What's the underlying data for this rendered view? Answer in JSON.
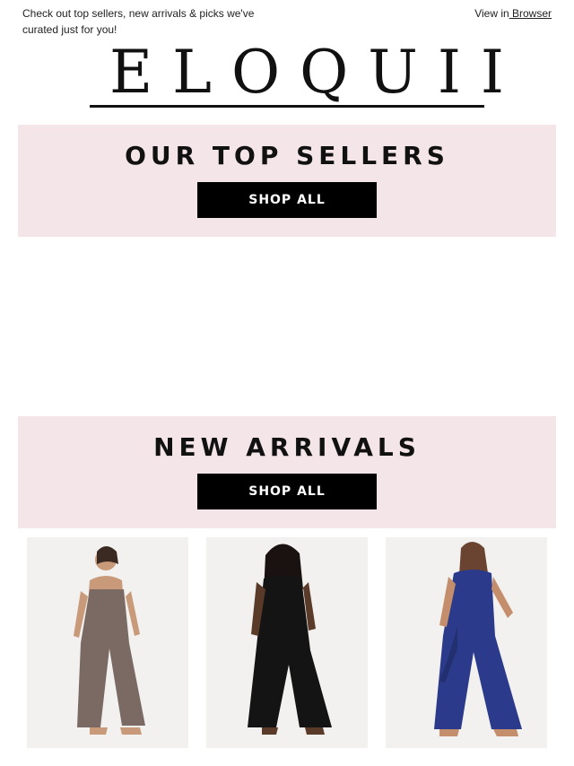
{
  "preheader": {
    "text": "Check out top sellers, new arrivals & picks we've curated just for you!",
    "view_in_label": "View in",
    "browser_link": " Browser"
  },
  "brand": {
    "logo_text": "ELOQUII"
  },
  "sections": [
    {
      "title": "OUR TOP SELLERS",
      "button_label": "SHOP ALL"
    },
    {
      "title": "NEW ARRIVALS",
      "button_label": "SHOP ALL"
    }
  ],
  "products": [
    {
      "image": "model-in-sequin-strapless-jumpsuit",
      "color": "#7a6a63"
    },
    {
      "image": "model-in-black-jumpsuit-with-vest",
      "color": "#141414"
    },
    {
      "image": "model-in-navy-halter-pleated-jumpsuit",
      "color": "#2b3a8a"
    }
  ],
  "colors": {
    "band": "#f4e5e8",
    "button": "#000000",
    "text": "#111111"
  }
}
